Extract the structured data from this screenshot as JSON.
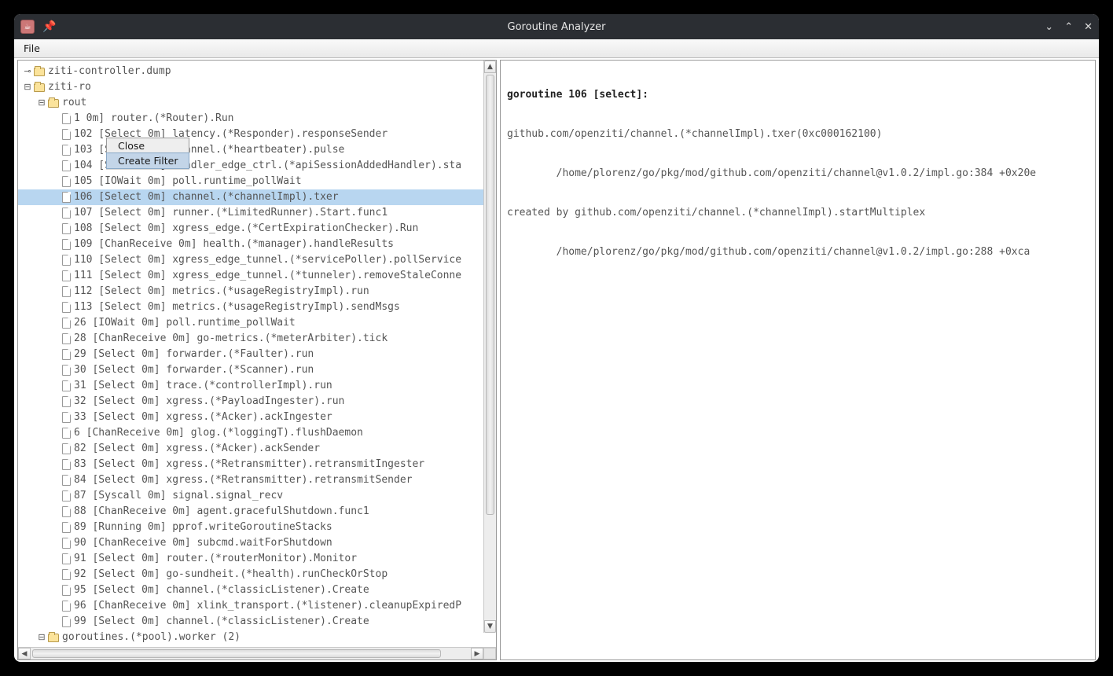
{
  "window": {
    "title": "Goroutine Analyzer"
  },
  "menubar": {
    "file": "File"
  },
  "context_menu": {
    "close": "Close",
    "create_filter": "Create Filter"
  },
  "tree": {
    "root1": "ziti-controller.dump",
    "root2": "ziti-ro",
    "branch": "rout",
    "partial_first": "1                         0m]  router.(*Router).Run",
    "items": [
      {
        "id": "102",
        "state": "Select 0m",
        "fn": "latency.(*Responder).responseSender"
      },
      {
        "id": "103",
        "state": "Select 0m",
        "fn": "channel.(*heartbeater).pulse"
      },
      {
        "id": "104",
        "state": "Select 0m",
        "fn": "handler_edge_ctrl.(*apiSessionAddedHandler).sta"
      },
      {
        "id": "105",
        "state": "IOWait 0m",
        "fn": "poll.runtime_pollWait"
      },
      {
        "id": "106",
        "state": "Select 0m",
        "fn": "channel.(*channelImpl).txer",
        "selected": true
      },
      {
        "id": "107",
        "state": "Select 0m",
        "fn": "runner.(*LimitedRunner).Start.func1"
      },
      {
        "id": "108",
        "state": "Select 0m",
        "fn": "xgress_edge.(*CertExpirationChecker).Run"
      },
      {
        "id": "109",
        "state": "ChanReceive 0m",
        "fn": "health.(*manager).handleResults"
      },
      {
        "id": "110",
        "state": "Select 0m",
        "fn": "xgress_edge_tunnel.(*servicePoller).pollService"
      },
      {
        "id": "111",
        "state": "Select 0m",
        "fn": "xgress_edge_tunnel.(*tunneler).removeStaleConne"
      },
      {
        "id": "112",
        "state": "Select 0m",
        "fn": "metrics.(*usageRegistryImpl).run"
      },
      {
        "id": "113",
        "state": "Select 0m",
        "fn": "metrics.(*usageRegistryImpl).sendMsgs"
      },
      {
        "id": "26",
        "state": "IOWait 0m",
        "fn": "poll.runtime_pollWait"
      },
      {
        "id": "28",
        "state": "ChanReceive 0m",
        "fn": "go-metrics.(*meterArbiter).tick"
      },
      {
        "id": "29",
        "state": "Select 0m",
        "fn": "forwarder.(*Faulter).run"
      },
      {
        "id": "30",
        "state": "Select 0m",
        "fn": "forwarder.(*Scanner).run"
      },
      {
        "id": "31",
        "state": "Select 0m",
        "fn": "trace.(*controllerImpl).run"
      },
      {
        "id": "32",
        "state": "Select 0m",
        "fn": "xgress.(*PayloadIngester).run"
      },
      {
        "id": "33",
        "state": "Select 0m",
        "fn": "xgress.(*Acker).ackIngester"
      },
      {
        "id": "6",
        "state": "ChanReceive 0m",
        "fn": "glog.(*loggingT).flushDaemon"
      },
      {
        "id": "82",
        "state": "Select 0m",
        "fn": "xgress.(*Acker).ackSender"
      },
      {
        "id": "83",
        "state": "Select 0m",
        "fn": "xgress.(*Retransmitter).retransmitIngester"
      },
      {
        "id": "84",
        "state": "Select 0m",
        "fn": "xgress.(*Retransmitter).retransmitSender"
      },
      {
        "id": "87",
        "state": "Syscall 0m",
        "fn": "signal.signal_recv"
      },
      {
        "id": "88",
        "state": "ChanReceive 0m",
        "fn": "agent.gracefulShutdown.func1"
      },
      {
        "id": "89",
        "state": "Running 0m",
        "fn": "pprof.writeGoroutineStacks"
      },
      {
        "id": "90",
        "state": "ChanReceive 0m",
        "fn": "subcmd.waitForShutdown"
      },
      {
        "id": "91",
        "state": "Select 0m",
        "fn": "router.(*routerMonitor).Monitor"
      },
      {
        "id": "92",
        "state": "Select 0m",
        "fn": "go-sundheit.(*health).runCheckOrStop"
      },
      {
        "id": "95",
        "state": "Select 0m",
        "fn": "channel.(*classicListener).Create"
      },
      {
        "id": "96",
        "state": "ChanReceive 0m",
        "fn": "xlink_transport.(*listener).cleanupExpiredP"
      },
      {
        "id": "99",
        "state": "Select 0m",
        "fn": "channel.(*classicListener).Create"
      }
    ],
    "tail_group": "goroutines.(*pool).worker (2)"
  },
  "detail": {
    "line1_a": "goroutine 106 [select]:",
    "line2": "github.com/openziti/channel.(*channelImpl).txer(0xc000162100)",
    "line3": "        /home/plorenz/go/pkg/mod/github.com/openziti/channel@v1.0.2/impl.go:384 +0x20e",
    "line4": "created by github.com/openziti/channel.(*channelImpl).startMultiplex",
    "line5": "        /home/plorenz/go/pkg/mod/github.com/openziti/channel@v1.0.2/impl.go:288 +0xca"
  }
}
